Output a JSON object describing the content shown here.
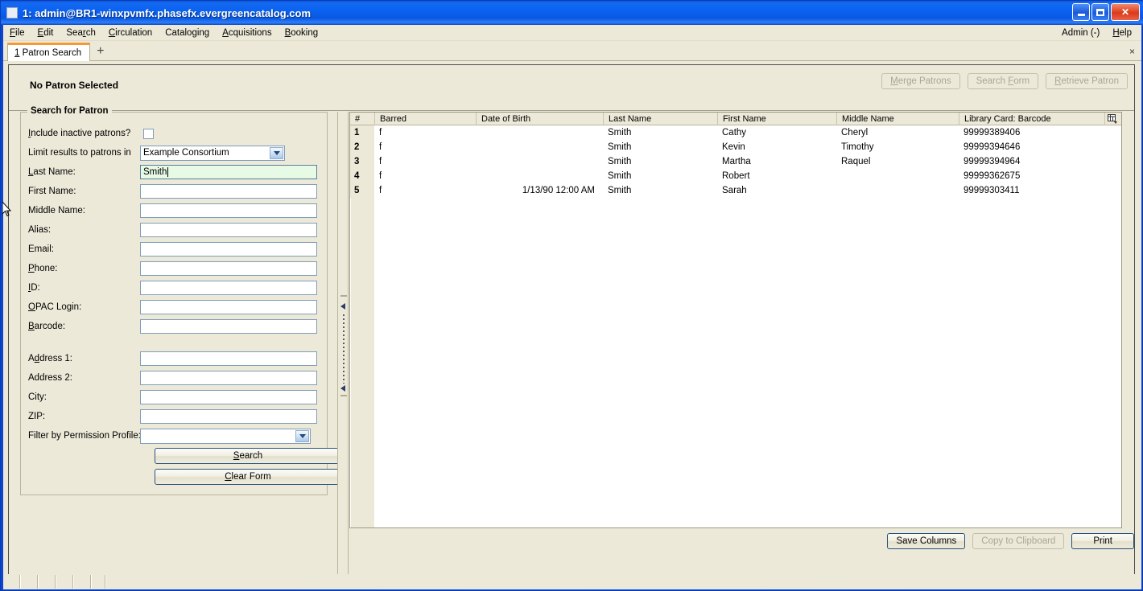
{
  "window": {
    "title": "1: admin@BR1-winxpvmfx.phasefx.evergreencatalog.com",
    "minimize_label": "",
    "maximize_label": "",
    "close_label": "✕"
  },
  "menubar": {
    "items": [
      {
        "label": "File",
        "accel": "F"
      },
      {
        "label": "Edit",
        "accel": "E"
      },
      {
        "label": "Search",
        "accel": "r"
      },
      {
        "label": "Circulation",
        "accel": "C"
      },
      {
        "label": "Cataloging",
        "accel": "g"
      },
      {
        "label": "Acquisitions",
        "accel": "A"
      },
      {
        "label": "Booking",
        "accel": "B"
      }
    ],
    "right_items": [
      {
        "label": "Admin (-)"
      },
      {
        "label": "Help",
        "accel": "H"
      }
    ]
  },
  "tabs": {
    "active": {
      "index": "1",
      "label": "Patron Search"
    },
    "add_label": "+",
    "close_label": "×"
  },
  "patron_header": {
    "title": "No Patron Selected",
    "buttons": [
      {
        "label": "Merge Patrons",
        "disabled": true
      },
      {
        "label": "Search Form",
        "disabled": true
      },
      {
        "label": "Retrieve Patron",
        "disabled": true
      }
    ]
  },
  "search_form": {
    "legend": "Search for Patron",
    "include_inactive": {
      "label": "Include inactive patrons?",
      "checked": false
    },
    "limit_results": {
      "label": "Limit results to patrons in",
      "value": "Example Consortium"
    },
    "fields": [
      {
        "label": "Last Name:",
        "value": "Smith",
        "focused": true
      },
      {
        "label": "First Name:",
        "value": "",
        "focused": false
      },
      {
        "label": "Middle Name:",
        "value": "",
        "focused": false
      },
      {
        "label": "Alias:",
        "value": "",
        "focused": false
      },
      {
        "label": "Email:",
        "value": "",
        "focused": false
      },
      {
        "label": "Phone:",
        "value": "",
        "focused": false
      },
      {
        "label": "ID:",
        "value": "",
        "focused": false
      },
      {
        "label": "OPAC Login:",
        "value": "",
        "focused": false
      },
      {
        "label": "Barcode:",
        "value": "",
        "focused": false
      }
    ],
    "address_fields": [
      {
        "label": "Address 1:",
        "value": ""
      },
      {
        "label": "Address 2:",
        "value": ""
      },
      {
        "label": "City:",
        "value": ""
      },
      {
        "label": "ZIP:",
        "value": ""
      }
    ],
    "permission_profile": {
      "label": "Filter by Permission Profile:",
      "value": ""
    },
    "search_button": "Search",
    "clear_button": "Clear Form"
  },
  "results": {
    "columns": [
      "#",
      "Barred",
      "Date of Birth",
      "Last Name",
      "First Name",
      "Middle Name",
      "Library Card: Barcode"
    ],
    "rows": [
      {
        "num": "1",
        "barred": "f",
        "dob": "",
        "last": "Smith",
        "first": "Cathy",
        "middle": "Cheryl",
        "barcode": "99999389406"
      },
      {
        "num": "2",
        "barred": "f",
        "dob": "",
        "last": "Smith",
        "first": "Kevin",
        "middle": "Timothy",
        "barcode": "99999394646"
      },
      {
        "num": "3",
        "barred": "f",
        "dob": "",
        "last": "Smith",
        "first": "Martha",
        "middle": "Raquel",
        "barcode": "99999394964"
      },
      {
        "num": "4",
        "barred": "f",
        "dob": "",
        "last": "Smith",
        "first": "Robert",
        "middle": "",
        "barcode": "99999362675"
      },
      {
        "num": "5",
        "barred": "f",
        "dob": "1/13/90 12:00 AM",
        "last": "Smith",
        "first": "Sarah",
        "middle": "",
        "barcode": "99999303411"
      }
    ],
    "buttons": [
      {
        "label": "Save Columns",
        "disabled": false
      },
      {
        "label": "Copy to Clipboard",
        "disabled": true
      },
      {
        "label": "Print",
        "disabled": false
      }
    ]
  },
  "colors": {
    "window_chrome": "#ece9d8",
    "title_blue": "#0a58e2",
    "tab_accent": "#f79836",
    "focus_field": "#e6fae6"
  }
}
